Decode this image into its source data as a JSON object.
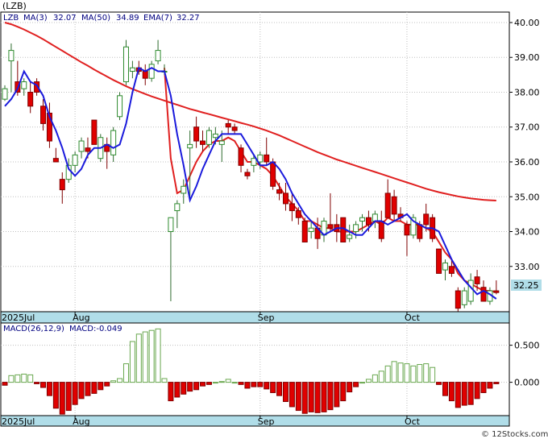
{
  "ticker": "(LZB)",
  "legend": {
    "symbol": "LZB",
    "ma3_label": "MA(3)",
    "ma3_value": "32.07",
    "ma50_label": "MA(50)",
    "ma50_value": "34.89",
    "ema7_label": "EMA(7)",
    "ema7_value": "32.27"
  },
  "last_price_tag": "32.25",
  "macd_legend": {
    "label": "MACD(26,12,9)",
    "value_label": "MACD:-0.049"
  },
  "watermark": "© 12Stocks.com",
  "colors": {
    "up_candle": "#2e8b2e",
    "down_candle": "#e00000",
    "ma3": "#1a1adc",
    "ma50": "#e02020",
    "ema7": "#e02020",
    "macd_up": "#6aa84f",
    "macd_down": "#e00000",
    "axis_band": "#b0dde8",
    "tag_bg": "#b0dde8"
  },
  "chart_data": [
    {
      "type": "candlestick",
      "title": "(LZB)",
      "x_month_labels": [
        "2025Jul",
        "Aug",
        "Sep",
        "Oct"
      ],
      "month_label_index": [
        0,
        11,
        40,
        63
      ],
      "y_ticks": [
        33.0,
        34.0,
        35.0,
        36.0,
        37.0,
        38.0,
        39.0,
        40.0
      ],
      "ylim": [
        31.7,
        40.3
      ],
      "grid": true,
      "ohlc": [
        [
          37.8,
          38.2,
          37.75,
          38.1
        ],
        [
          38.9,
          39.4,
          38.0,
          39.2
        ],
        [
          38.3,
          38.9,
          37.9,
          38.0
        ],
        [
          38.1,
          38.4,
          37.9,
          38.3
        ],
        [
          38.0,
          38.3,
          37.4,
          37.6
        ],
        [
          38.3,
          38.4,
          37.9,
          38.0
        ],
        [
          37.6,
          37.8,
          36.9,
          37.1
        ],
        [
          37.4,
          37.7,
          36.4,
          36.6
        ],
        [
          36.1,
          36.4,
          36.0,
          36.0
        ],
        [
          35.5,
          35.7,
          34.8,
          35.2
        ],
        [
          35.5,
          36.1,
          35.4,
          35.9
        ],
        [
          35.9,
          36.3,
          35.7,
          36.2
        ],
        [
          36.3,
          36.7,
          36.1,
          36.6
        ],
        [
          36.4,
          36.7,
          36.1,
          36.3
        ],
        [
          37.2,
          37.2,
          36.5,
          36.5
        ],
        [
          36.1,
          36.8,
          36.0,
          36.7
        ],
        [
          36.5,
          36.7,
          35.8,
          36.3
        ],
        [
          36.2,
          37.0,
          36.0,
          36.9
        ],
        [
          37.3,
          38.0,
          37.2,
          37.9
        ],
        [
          38.3,
          39.5,
          38.2,
          39.3
        ],
        [
          38.6,
          38.9,
          38.4,
          38.7
        ],
        [
          38.7,
          38.9,
          38.5,
          38.6
        ],
        [
          38.6,
          38.8,
          38.2,
          38.4
        ],
        [
          38.4,
          38.9,
          38.3,
          38.8
        ],
        [
          38.9,
          39.5,
          38.8,
          39.2
        ],
        [
          38.6,
          38.8,
          38.5,
          38.6
        ],
        [
          34.0,
          34.4,
          32.0,
          34.4
        ],
        [
          34.6,
          34.9,
          34.1,
          34.8
        ],
        [
          35.1,
          35.5,
          34.8,
          35.3
        ],
        [
          36.4,
          36.9,
          35.0,
          36.5
        ],
        [
          37.0,
          37.3,
          36.4,
          36.6
        ],
        [
          36.6,
          36.9,
          36.3,
          36.5
        ],
        [
          36.5,
          37.0,
          36.4,
          36.9
        ],
        [
          36.7,
          37.0,
          36.5,
          36.8
        ],
        [
          36.5,
          36.9,
          36.0,
          36.6
        ],
        [
          37.1,
          37.2,
          36.8,
          37.0
        ],
        [
          37.0,
          37.1,
          36.8,
          36.9
        ],
        [
          36.4,
          36.5,
          35.7,
          35.9
        ],
        [
          35.7,
          35.8,
          35.5,
          35.6
        ],
        [
          35.9,
          36.2,
          35.7,
          36.1
        ],
        [
          36.0,
          36.3,
          35.8,
          36.2
        ],
        [
          36.2,
          36.7,
          35.9,
          36.0
        ],
        [
          36.0,
          36.1,
          35.2,
          35.3
        ],
        [
          35.2,
          35.4,
          34.9,
          35.1
        ],
        [
          35.1,
          35.4,
          34.6,
          34.8
        ],
        [
          34.8,
          35.1,
          34.3,
          34.6
        ],
        [
          34.6,
          34.7,
          34.2,
          34.4
        ],
        [
          34.3,
          34.4,
          33.7,
          33.7
        ],
        [
          34.0,
          34.3,
          33.8,
          34.1
        ],
        [
          34.1,
          34.4,
          33.5,
          33.8
        ],
        [
          33.9,
          34.4,
          33.7,
          34.3
        ],
        [
          34.2,
          35.1,
          34.0,
          34.1
        ],
        [
          34.2,
          34.5,
          33.7,
          34.0
        ],
        [
          34.4,
          34.4,
          33.7,
          33.7
        ],
        [
          33.8,
          34.2,
          33.7,
          33.9
        ],
        [
          34.0,
          34.3,
          33.8,
          34.2
        ],
        [
          34.3,
          34.5,
          34.0,
          34.4
        ],
        [
          34.4,
          34.6,
          34.0,
          34.2
        ],
        [
          34.3,
          34.6,
          34.1,
          34.5
        ],
        [
          34.3,
          34.6,
          33.7,
          33.8
        ],
        [
          35.1,
          35.5,
          34.4,
          34.4
        ],
        [
          35.0,
          35.2,
          34.3,
          34.5
        ],
        [
          34.5,
          34.7,
          34.3,
          34.4
        ],
        [
          34.2,
          34.3,
          33.3,
          33.9
        ],
        [
          33.9,
          34.5,
          33.8,
          34.4
        ],
        [
          34.2,
          34.3,
          33.7,
          33.8
        ],
        [
          34.5,
          34.8,
          34.0,
          34.2
        ],
        [
          34.4,
          34.5,
          33.7,
          33.8
        ],
        [
          33.5,
          33.5,
          32.8,
          32.8
        ],
        [
          32.9,
          33.2,
          32.6,
          33.1
        ],
        [
          33.0,
          33.2,
          32.7,
          32.8
        ],
        [
          32.3,
          32.4,
          31.7,
          31.8
        ],
        [
          31.9,
          32.4,
          31.8,
          32.3
        ],
        [
          32.0,
          32.8,
          31.9,
          32.6
        ],
        [
          32.7,
          32.9,
          32.3,
          32.5
        ],
        [
          32.4,
          32.6,
          32.0,
          32.0
        ],
        [
          32.0,
          32.4,
          31.9,
          32.3
        ],
        [
          32.3,
          32.6,
          32.2,
          32.25
        ]
      ],
      "ma3": [
        37.6,
        37.8,
        38.1,
        38.6,
        38.3,
        38.2,
        37.9,
        37.3,
        36.9,
        36.4,
        35.8,
        35.6,
        35.8,
        36.2,
        36.4,
        36.4,
        36.5,
        36.4,
        36.5,
        37.1,
        38.0,
        38.7,
        38.6,
        38.7,
        38.6,
        38.6,
        37.9,
        36.8,
        35.9,
        34.9,
        35.3,
        35.8,
        36.2,
        36.6,
        36.8,
        36.8,
        36.8,
        36.8,
        36.5,
        36.2,
        35.9,
        35.9,
        36.0,
        35.8,
        35.5,
        35.1,
        34.8,
        34.5,
        34.3,
        34.1,
        33.9,
        34.0,
        34.1,
        34.1,
        34.0,
        33.9,
        33.9,
        34.1,
        34.3,
        34.3,
        34.2,
        34.3,
        34.4,
        34.5,
        34.3,
        34.2,
        34.1,
        34.1,
        34.0,
        33.6,
        33.2,
        32.9,
        32.6,
        32.4,
        32.2,
        32.3,
        32.2,
        32.07
      ],
      "ma50": [
        40.0,
        39.95,
        39.88,
        39.8,
        39.71,
        39.62,
        39.52,
        39.41,
        39.3,
        39.19,
        39.08,
        38.97,
        38.86,
        38.76,
        38.65,
        38.55,
        38.45,
        38.35,
        38.26,
        38.17,
        38.09,
        38.02,
        37.95,
        37.88,
        37.82,
        37.76,
        37.7,
        37.64,
        37.58,
        37.52,
        37.47,
        37.42,
        37.37,
        37.32,
        37.27,
        37.22,
        37.17,
        37.12,
        37.07,
        37.02,
        36.96,
        36.9,
        36.83,
        36.76,
        36.68,
        36.6,
        36.52,
        36.44,
        36.36,
        36.28,
        36.21,
        36.14,
        36.07,
        36.01,
        35.95,
        35.89,
        35.83,
        35.77,
        35.71,
        35.65,
        35.59,
        35.53,
        35.47,
        35.41,
        35.35,
        35.29,
        35.23,
        35.18,
        35.13,
        35.09,
        35.05,
        35.01,
        34.98,
        34.95,
        34.93,
        34.91,
        34.9,
        34.89
      ],
      "ema7": [
        null,
        null,
        null,
        null,
        null,
        null,
        null,
        null,
        null,
        null,
        null,
        null,
        null,
        null,
        null,
        null,
        null,
        null,
        null,
        null,
        null,
        null,
        null,
        null,
        null,
        38.7,
        36.1,
        35.1,
        35.2,
        35.6,
        36.0,
        36.3,
        36.5,
        36.6,
        36.6,
        36.7,
        36.6,
        36.3,
        36.0,
        36.0,
        35.9,
        35.8,
        35.6,
        35.3,
        35.0,
        34.8,
        34.6,
        34.3,
        34.3,
        34.2,
        34.1,
        34.1,
        34.0,
        34.0,
        34.0,
        34.0,
        34.1,
        34.2,
        34.3,
        34.2,
        34.4,
        34.3,
        34.3,
        34.2,
        34.2,
        34.2,
        34.1,
        34.0,
        33.7,
        33.4,
        33.2,
        32.8,
        32.6,
        32.5,
        32.4,
        32.3,
        32.3,
        32.27
      ],
      "macd_hist_label_ticks": [
        "0.500",
        "0.000"
      ],
      "macd_ylim": [
        -0.45,
        0.8
      ],
      "macd_hist": [
        -0.04,
        0.09,
        0.1,
        0.11,
        0.1,
        -0.02,
        -0.07,
        -0.18,
        -0.35,
        -0.43,
        -0.38,
        -0.3,
        -0.22,
        -0.18,
        -0.15,
        -0.1,
        -0.05,
        0.02,
        0.05,
        0.25,
        0.55,
        0.65,
        0.68,
        0.7,
        0.72,
        0.05,
        -0.25,
        -0.2,
        -0.16,
        -0.12,
        -0.1,
        -0.05,
        -0.03,
        0.0,
        0.01,
        0.04,
        0.0,
        -0.03,
        -0.08,
        -0.06,
        -0.06,
        -0.09,
        -0.14,
        -0.18,
        -0.26,
        -0.33,
        -0.38,
        -0.42,
        -0.4,
        -0.41,
        -0.4,
        -0.37,
        -0.33,
        -0.25,
        -0.13,
        -0.06,
        0.0,
        0.04,
        0.1,
        0.15,
        0.22,
        0.28,
        0.26,
        0.25,
        0.22,
        0.24,
        0.25,
        0.2,
        -0.03,
        -0.18,
        -0.25,
        -0.34,
        -0.31,
        -0.3,
        -0.22,
        -0.14,
        -0.08,
        -0.02
      ]
    }
  ]
}
